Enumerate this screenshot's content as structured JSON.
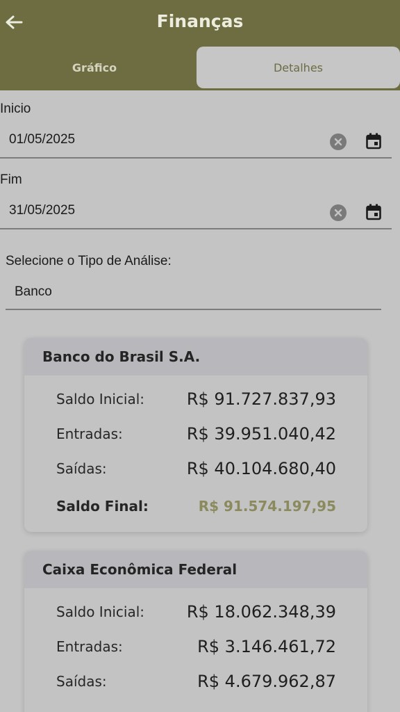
{
  "appbar": {
    "title": "Finanças",
    "back_icon": "arrow-left-icon"
  },
  "tabs": [
    {
      "label": "Gráfico",
      "selected": false
    },
    {
      "label": "Detalhes",
      "selected": true
    }
  ],
  "filters": {
    "start": {
      "label": "Inicio",
      "value": "01/05/2025"
    },
    "end": {
      "label": "Fim",
      "value": "31/05/2025"
    },
    "analysis_type": {
      "label": "Selecione o Tipo de Análise:",
      "value": "Banco"
    }
  },
  "colors": {
    "accent": "#6e6d42",
    "final_balance": "#8b8a5e",
    "background": "#c4c4c4"
  },
  "banks": [
    {
      "name": "Banco do Brasil S.A.",
      "rows": [
        {
          "label": "Saldo Inicial:",
          "value": "R$ 91.727.837,93"
        },
        {
          "label": "Entradas:",
          "value": "R$ 39.951.040,42"
        },
        {
          "label": "Saídas:",
          "value": "R$ 40.104.680,40"
        }
      ],
      "final": {
        "label": "Saldo Final:",
        "value": "R$ 91.574.197,95"
      }
    },
    {
      "name": "Caixa Econômica Federal",
      "rows": [
        {
          "label": "Saldo Inicial:",
          "value": "R$ 18.062.348,39"
        },
        {
          "label": "Entradas:",
          "value": "R$ 3.146.461,72"
        },
        {
          "label": "Saídas:",
          "value": "R$ 4.679.962,87"
        }
      ]
    }
  ]
}
